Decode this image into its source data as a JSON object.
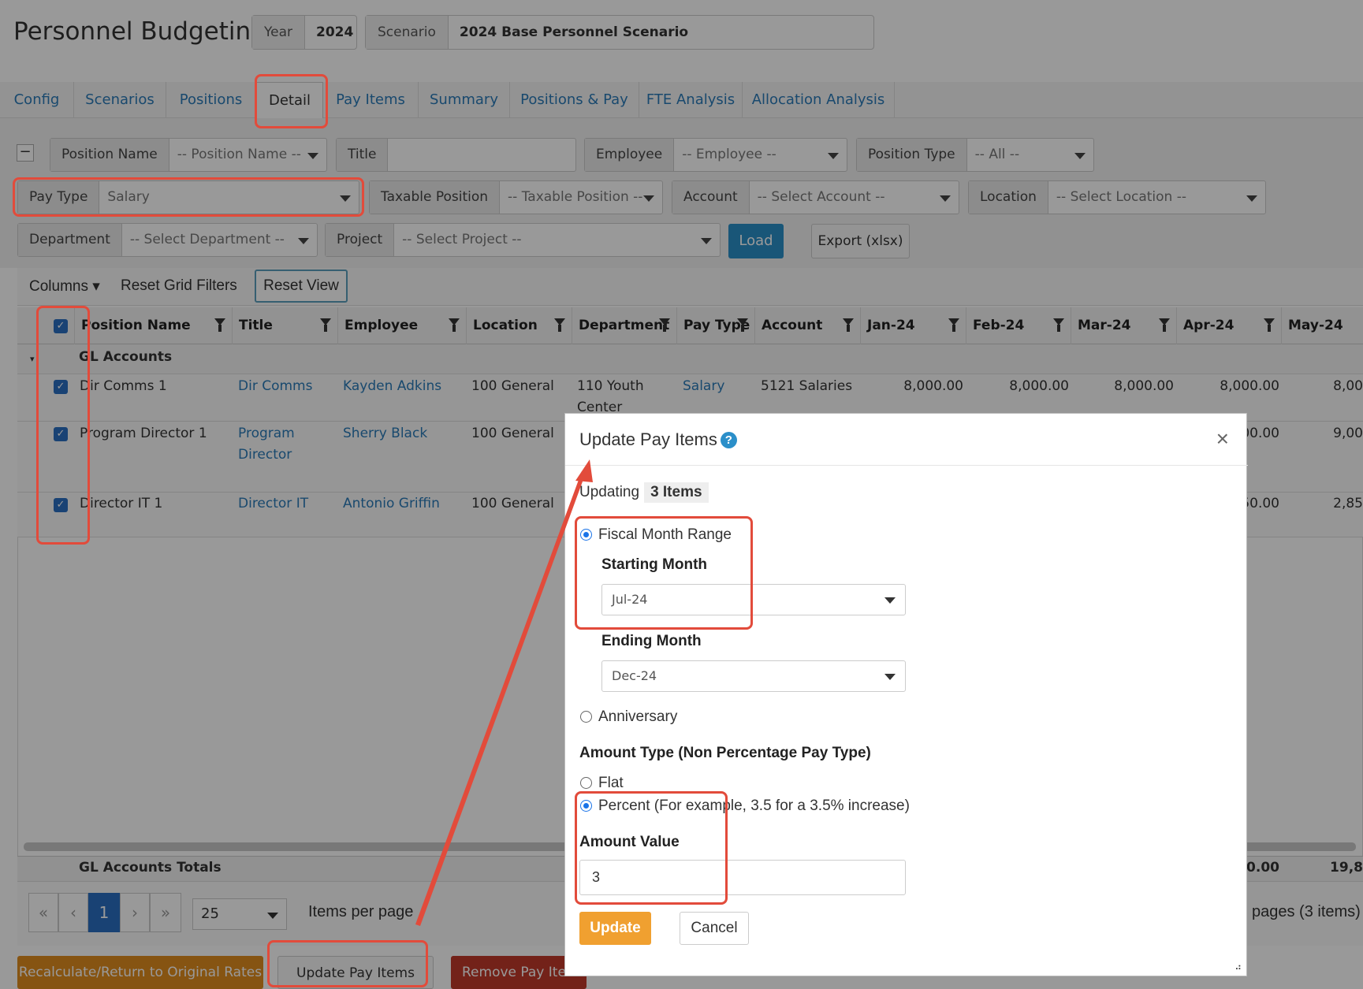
{
  "header": {
    "title": "Personnel Budgeting",
    "year_label": "Year",
    "year_value": "2024",
    "scenario_label": "Scenario",
    "scenario_value": "2024 Base Personnel Scenario"
  },
  "tabs": [
    "Config",
    "Scenarios",
    "Positions",
    "Detail",
    "Pay Items",
    "Summary",
    "Positions & Pay",
    "FTE Analysis",
    "Allocation Analysis"
  ],
  "filters": {
    "collapse": "−",
    "position_name": {
      "label": "Position Name",
      "value": "-- Position Name --"
    },
    "title": {
      "label": "Title",
      "value": ""
    },
    "employee": {
      "label": "Employee",
      "value": "-- Employee --"
    },
    "position_type": {
      "label": "Position Type",
      "value": "-- All --"
    },
    "pay_type": {
      "label": "Pay Type",
      "value": "Salary"
    },
    "taxable_position": {
      "label": "Taxable Position",
      "value": "-- Taxable Position --"
    },
    "account": {
      "label": "Account",
      "value": "-- Select Account --"
    },
    "location": {
      "label": "Location",
      "value": "-- Select Location --"
    },
    "department": {
      "label": "Department",
      "value": "-- Select Department --"
    },
    "project": {
      "label": "Project",
      "value": "-- Select Project --"
    },
    "load": "Load",
    "export": "Export (xlsx)"
  },
  "toolbar": {
    "columns": "Columns ▾",
    "reset_filters": "Reset Grid Filters",
    "reset_view": "Reset View"
  },
  "grid": {
    "columns": [
      "Position Name",
      "Title",
      "Employee",
      "Location",
      "Department",
      "Pay Type",
      "Account",
      "Jan-24",
      "Feb-24",
      "Mar-24",
      "Apr-24",
      "May-24"
    ],
    "group": "GL Accounts",
    "rows": [
      {
        "position": "Dir Comms 1",
        "title": "Dir Comms",
        "employee": "Kayden Adkins",
        "location": "100 General",
        "department": "110 Youth Center",
        "pay_type": "Salary",
        "account": "5121 Salaries",
        "jan": "8,000.00",
        "feb": "8,000.00",
        "mar": "8,000.00",
        "apr": "8,000.00",
        "may": "8,00"
      },
      {
        "position": "Program Director 1",
        "title": "Program Director",
        "employee": "Sherry Black",
        "location": "100 General",
        "apr": "00.00",
        "may": "9,00"
      },
      {
        "position": "Director IT 1",
        "title": "Director IT",
        "employee": "Antonio Griffin",
        "location": "100 General",
        "apr": "50.00",
        "may": "2,85"
      }
    ],
    "totals_label": "GL Accounts Totals",
    "totals_apr": "50.00",
    "totals_may": "19,8"
  },
  "pager": {
    "first": "«",
    "prev": "‹",
    "page": "1",
    "next": "›",
    "last": "»",
    "per_page": "25",
    "per_page_label": "Items per page",
    "summary": "pages (3 items)"
  },
  "bottom_buttons": {
    "recalc": "Recalculate/Return to Original Rates",
    "update": "Update Pay Items",
    "remove": "Remove Pay Iten"
  },
  "modal": {
    "title": "Update Pay Items",
    "help": "?",
    "close": "×",
    "updating_label": "Updating",
    "updating_count": "3 Items",
    "fiscal_range": "Fiscal Month Range",
    "starting_month_label": "Starting Month",
    "starting_month": "Jul-24",
    "ending_month_label": "Ending Month",
    "ending_month": "Dec-24",
    "anniversary": "Anniversary",
    "amount_type_label": "Amount Type (Non Percentage Pay Type)",
    "flat": "Flat",
    "percent": "Percent (For example, 3.5 for a 3.5% increase)",
    "amount_value_label": "Amount Value",
    "amount_value": "3",
    "update": "Update",
    "cancel": "Cancel"
  },
  "colors": {
    "accent": "#2b8fc9",
    "annotation": "#e24b3b",
    "update_button": "#f0a030",
    "remove_button": "#c0392b"
  }
}
